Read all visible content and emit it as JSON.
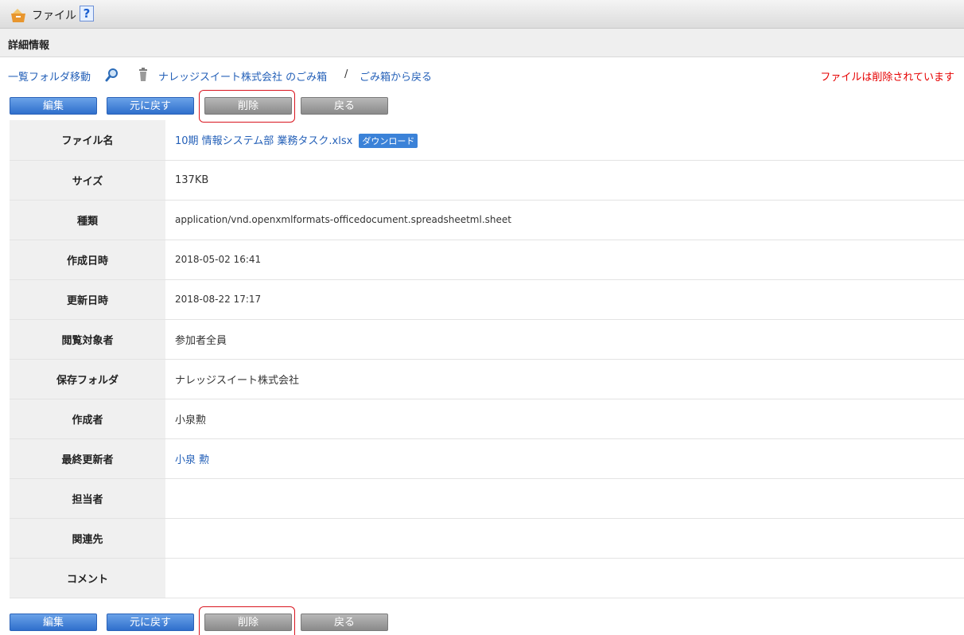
{
  "header": {
    "title": "ファイル",
    "help": "?"
  },
  "section": {
    "title": "詳細情報"
  },
  "nav": {
    "folder_move": "一覧フォルダ移動",
    "trash_link": "ナレッジスイート株式会社 のごみ箱",
    "separator": "/",
    "back_from_trash": "ごみ箱から戻る",
    "deleted_message": "ファイルは削除されています"
  },
  "buttons": {
    "edit": "編集",
    "restore": "元に戻す",
    "delete": "削除",
    "back": "戻る"
  },
  "details": {
    "filename_label": "ファイル名",
    "filename": "10期 情報システム部 業務タスク.xlsx",
    "download": "ダウンロード",
    "size_label": "サイズ",
    "size": "137KB",
    "type_label": "種類",
    "type": "application/vnd.openxmlformats-officedocument.spreadsheetml.sheet",
    "created_label": "作成日時",
    "created": "2018-05-02 16:41",
    "updated_label": "更新日時",
    "updated": "2018-08-22 17:17",
    "viewers_label": "閲覧対象者",
    "viewers": "参加者全員",
    "folder_label": "保存フォルダ",
    "folder": "ナレッジスイート株式会社",
    "creator_label": "作成者",
    "creator": "小泉勲",
    "last_updater_label": "最終更新者",
    "last_updater": "小泉 勲",
    "assignee_label": "担当者",
    "assignee": "",
    "related_label": "関連先",
    "related": "",
    "comment_label": "コメント",
    "comment": ""
  },
  "colors": {
    "link": "#2460b8",
    "alert": "#e60000",
    "highlight": "#d9141e"
  }
}
